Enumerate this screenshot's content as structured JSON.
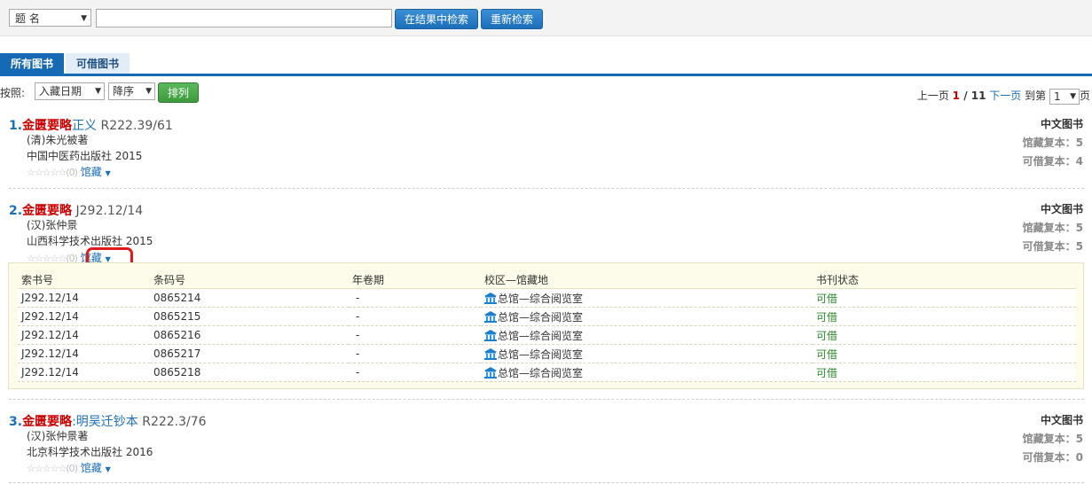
{
  "search": {
    "field_value": "题  名",
    "input_value": "",
    "btn_within": "在结果中检索",
    "btn_new": "重新检索"
  },
  "tabs": {
    "all": "所有图书",
    "available": "可借图书"
  },
  "sort": {
    "label": "按照:",
    "field": "入藏日期",
    "order": "降序",
    "btn": "排列"
  },
  "pager": {
    "prev": "上一页",
    "current": "1",
    "slash": " / ",
    "total": "11",
    "next": "下一页",
    "goto": "到第",
    "page_value": "1",
    "page_suffix": "页"
  },
  "results": [
    {
      "index": "1.",
      "title_hl": "金匮要略",
      "title_rest": "正义",
      "call_no": "R222.39/61",
      "author": "(清)朱光被著",
      "publisher": "中国中医药出版社 2015",
      "rating": "☆☆☆☆☆(0)",
      "holdings": "馆藏",
      "type": "中文图书",
      "copies": "馆藏复本：5",
      "available": "可借复本：4"
    },
    {
      "index": "2.",
      "title_hl": "金匮要略",
      "title_rest": "",
      "call_no": "J292.12/14",
      "author": "(汉)张仲景",
      "publisher": "山西科学技术出版社 2015",
      "rating": "☆☆☆☆☆(0)",
      "holdings": "馆藏",
      "type": "中文图书",
      "copies": "馆藏复本：5",
      "available": "可借复本：5"
    },
    {
      "index": "3.",
      "title_hl": "金匮要略",
      "title_rest": ":明吴迁钞本",
      "call_no": "R222.3/76",
      "author": "(汉)张仲景著",
      "publisher": "北京科学技术出版社 2016",
      "rating": "☆☆☆☆☆(0)",
      "holdings": "馆藏",
      "type": "中文图书",
      "copies": "馆藏复本：5",
      "available": "可借复本：0"
    }
  ],
  "holdings_table": {
    "headers": [
      "索书号",
      "条码号",
      "年卷期",
      "校区—馆藏地",
      "书刊状态"
    ],
    "rows": [
      [
        "J292.12/14",
        "0865214",
        "-",
        "总馆—综合阅览室",
        "可借"
      ],
      [
        "J292.12/14",
        "0865215",
        "-",
        "总馆—综合阅览室",
        "可借"
      ],
      [
        "J292.12/14",
        "0865216",
        "-",
        "总馆—综合阅览室",
        "可借"
      ],
      [
        "J292.12/14",
        "0865217",
        "-",
        "总馆—综合阅览室",
        "可借"
      ],
      [
        "J292.12/14",
        "0865218",
        "-",
        "总馆—综合阅览室",
        "可借"
      ]
    ]
  },
  "icons": {
    "library": "library-building-icon",
    "dropdown": "caret-down-icon"
  },
  "colors": {
    "accent": "#1669b4",
    "highlight": "#cc0000",
    "available": "#2d8b2d",
    "annotation": "#e01a1a"
  }
}
